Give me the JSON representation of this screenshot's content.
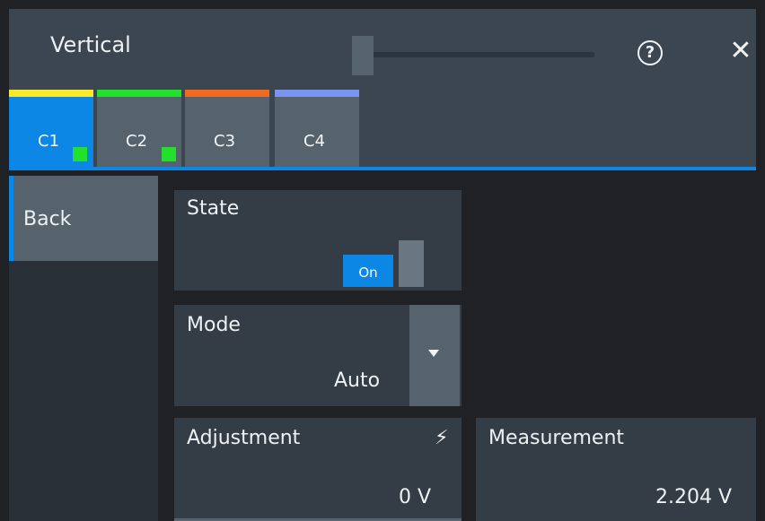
{
  "header": {
    "title": "Vertical",
    "help_icon": "help-circle-icon",
    "close_icon": "close-icon"
  },
  "tabs": [
    {
      "label": "C1",
      "color": "#f7ea2b",
      "active": true,
      "enabled": true
    },
    {
      "label": "C2",
      "color": "#22e12c",
      "active": false,
      "enabled": true
    },
    {
      "label": "C3",
      "color": "#f06a22",
      "active": false,
      "enabled": false
    },
    {
      "label": "C4",
      "color": "#7b94f0",
      "active": false,
      "enabled": false
    }
  ],
  "sidebar": {
    "back_label": "Back"
  },
  "state": {
    "label": "State",
    "toggle_text": "On"
  },
  "mode": {
    "label": "Mode",
    "value": "Auto"
  },
  "adjustment": {
    "label": "Adjustment",
    "value": "0 V"
  },
  "measurement": {
    "label": "Measurement",
    "value": "2.204 V"
  },
  "colors": {
    "accent": "#0c87e6",
    "enabled_indicator": "#22e12c"
  }
}
